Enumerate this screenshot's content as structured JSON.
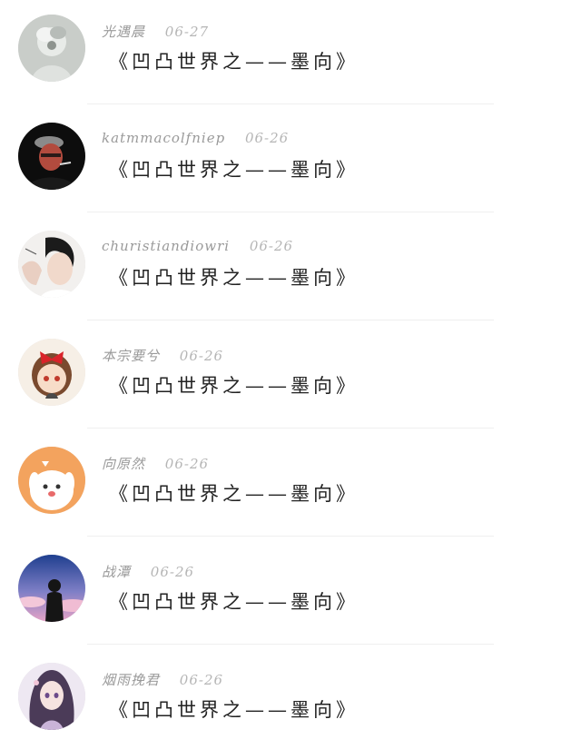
{
  "comments": [
    {
      "name": "光遇晨",
      "date": "06-27",
      "text": "《凹凸世界之——墨向》",
      "avatar": "avatar-grey-figure"
    },
    {
      "name": "katmmacolfniep",
      "date": "06-26",
      "text": "《凹凸世界之——墨向》",
      "avatar": "avatar-dark-smoker"
    },
    {
      "name": "churistiandiowri",
      "date": "06-26",
      "text": "《凹凸世界之——墨向》",
      "avatar": "avatar-portrait-boy"
    },
    {
      "name": "本宗要兮",
      "date": "06-26",
      "text": "《凹凸世界之——墨向》",
      "avatar": "avatar-bow-girl"
    },
    {
      "name": "向原然",
      "date": "06-26",
      "text": "《凹凸世界之——墨向》",
      "avatar": "avatar-white-dog"
    },
    {
      "name": "战潭",
      "date": "06-26",
      "text": "《凹凸世界之——墨向》",
      "avatar": "avatar-sky-silhouette"
    },
    {
      "name": "烟雨挽君",
      "date": "06-26",
      "text": "《凹凸世界之——墨向》",
      "avatar": "avatar-anime-girl"
    }
  ]
}
